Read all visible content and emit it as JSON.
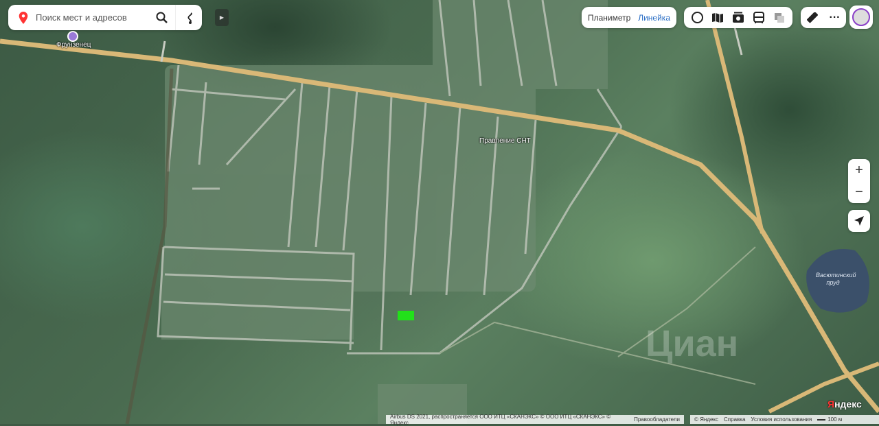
{
  "search": {
    "placeholder": "Поиск мест и адресов"
  },
  "toolbar": {
    "planimeter": "Планиметр",
    "ruler": "Линейка"
  },
  "layer_icons": [
    "panorama-icon",
    "map-layers-icon",
    "photo-icon",
    "transport-icon",
    "layers-stack-icon"
  ],
  "map_labels": {
    "village": "Фрунзенец",
    "board": "Правление СНТ",
    "pond": "Васютинский пруд"
  },
  "attribution": {
    "left": "Airbus DS 2021, распространяется ООО ИТЦ «СКАНЭКС» © ООО ИТЦ «СКАНЭКС» © Яндекс",
    "rights": "Правообладатели",
    "yandex": "© Яндекс",
    "help": "Справка",
    "terms": "Условия использования",
    "scale": "100 м"
  },
  "logo": {
    "first": "Я",
    "rest": "ндекс"
  },
  "watermark": "Циан",
  "colors": {
    "marker": "#22e01a",
    "road": "#d9b877",
    "accent": "#2a6ec5"
  }
}
